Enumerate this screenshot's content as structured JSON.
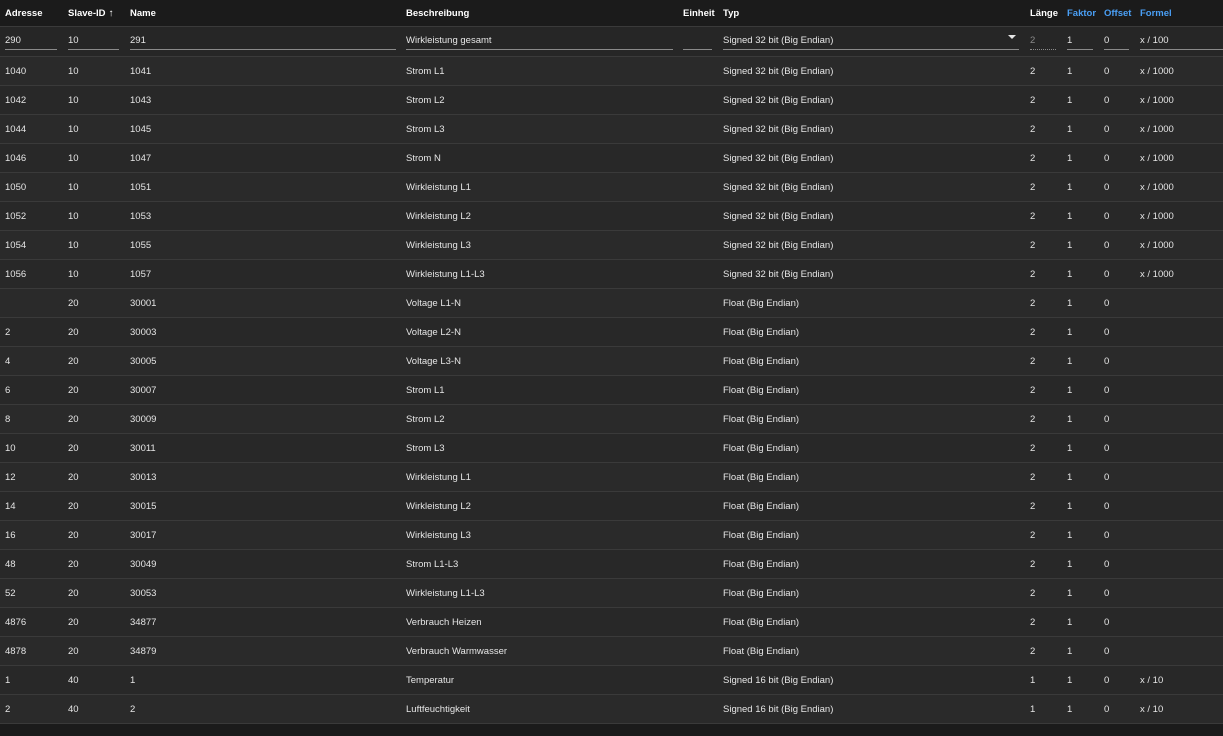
{
  "headers": {
    "adresse": "Adresse",
    "slave_id": "Slave-ID",
    "name": "Name",
    "beschreibung": "Beschreibung",
    "einheit": "Einheit",
    "typ": "Typ",
    "laenge": "Länge",
    "faktor": "Faktor",
    "offset": "Offset",
    "formel": "Formel",
    "sort_arrow": "↑"
  },
  "edit_row": {
    "adresse": "290",
    "slave_id": "10",
    "name": "291",
    "beschreibung": "Wirkleistung gesamt",
    "einheit": "",
    "typ": "Signed 32 bit (Big Endian)",
    "laenge": "2",
    "faktor": "1",
    "offset": "0",
    "formel": "x / 100"
  },
  "rows": [
    {
      "adresse": "1040",
      "slave_id": "10",
      "name": "1041",
      "beschreibung": "Strom L1",
      "einheit": "",
      "typ": "Signed 32 bit (Big Endian)",
      "laenge": "2",
      "faktor": "1",
      "offset": "0",
      "formel": "x / 1000"
    },
    {
      "adresse": "1042",
      "slave_id": "10",
      "name": "1043",
      "beschreibung": "Strom L2",
      "einheit": "",
      "typ": "Signed 32 bit (Big Endian)",
      "laenge": "2",
      "faktor": "1",
      "offset": "0",
      "formel": "x / 1000"
    },
    {
      "adresse": "1044",
      "slave_id": "10",
      "name": "1045",
      "beschreibung": "Strom L3",
      "einheit": "",
      "typ": "Signed 32 bit (Big Endian)",
      "laenge": "2",
      "faktor": "1",
      "offset": "0",
      "formel": "x / 1000"
    },
    {
      "adresse": "1046",
      "slave_id": "10",
      "name": "1047",
      "beschreibung": "Strom N",
      "einheit": "",
      "typ": "Signed 32 bit (Big Endian)",
      "laenge": "2",
      "faktor": "1",
      "offset": "0",
      "formel": "x / 1000"
    },
    {
      "adresse": "1050",
      "slave_id": "10",
      "name": "1051",
      "beschreibung": "Wirkleistung L1",
      "einheit": "",
      "typ": "Signed 32 bit (Big Endian)",
      "laenge": "2",
      "faktor": "1",
      "offset": "0",
      "formel": "x / 1000"
    },
    {
      "adresse": "1052",
      "slave_id": "10",
      "name": "1053",
      "beschreibung": "Wirkleistung L2",
      "einheit": "",
      "typ": "Signed 32 bit (Big Endian)",
      "laenge": "2",
      "faktor": "1",
      "offset": "0",
      "formel": "x / 1000"
    },
    {
      "adresse": "1054",
      "slave_id": "10",
      "name": "1055",
      "beschreibung": "Wirkleistung L3",
      "einheit": "",
      "typ": "Signed 32 bit (Big Endian)",
      "laenge": "2",
      "faktor": "1",
      "offset": "0",
      "formel": "x / 1000"
    },
    {
      "adresse": "1056",
      "slave_id": "10",
      "name": "1057",
      "beschreibung": "Wirkleistung L1-L3",
      "einheit": "",
      "typ": "Signed 32 bit (Big Endian)",
      "laenge": "2",
      "faktor": "1",
      "offset": "0",
      "formel": "x / 1000"
    },
    {
      "adresse": "",
      "slave_id": "20",
      "name": "30001",
      "beschreibung": "Voltage L1-N",
      "einheit": "",
      "typ": "Float (Big Endian)",
      "laenge": "2",
      "faktor": "1",
      "offset": "0",
      "formel": ""
    },
    {
      "adresse": "2",
      "slave_id": "20",
      "name": "30003",
      "beschreibung": "Voltage L2-N",
      "einheit": "",
      "typ": "Float (Big Endian)",
      "laenge": "2",
      "faktor": "1",
      "offset": "0",
      "formel": ""
    },
    {
      "adresse": "4",
      "slave_id": "20",
      "name": "30005",
      "beschreibung": "Voltage L3-N",
      "einheit": "",
      "typ": "Float (Big Endian)",
      "laenge": "2",
      "faktor": "1",
      "offset": "0",
      "formel": ""
    },
    {
      "adresse": "6",
      "slave_id": "20",
      "name": "30007",
      "beschreibung": "Strom L1",
      "einheit": "",
      "typ": "Float (Big Endian)",
      "laenge": "2",
      "faktor": "1",
      "offset": "0",
      "formel": ""
    },
    {
      "adresse": "8",
      "slave_id": "20",
      "name": "30009",
      "beschreibung": "Strom L2",
      "einheit": "",
      "typ": "Float (Big Endian)",
      "laenge": "2",
      "faktor": "1",
      "offset": "0",
      "formel": ""
    },
    {
      "adresse": "10",
      "slave_id": "20",
      "name": "30011",
      "beschreibung": "Strom L3",
      "einheit": "",
      "typ": "Float (Big Endian)",
      "laenge": "2",
      "faktor": "1",
      "offset": "0",
      "formel": ""
    },
    {
      "adresse": "12",
      "slave_id": "20",
      "name": "30013",
      "beschreibung": "Wirkleistung L1",
      "einheit": "",
      "typ": "Float (Big Endian)",
      "laenge": "2",
      "faktor": "1",
      "offset": "0",
      "formel": ""
    },
    {
      "adresse": "14",
      "slave_id": "20",
      "name": "30015",
      "beschreibung": "Wirkleistung L2",
      "einheit": "",
      "typ": "Float (Big Endian)",
      "laenge": "2",
      "faktor": "1",
      "offset": "0",
      "formel": ""
    },
    {
      "adresse": "16",
      "slave_id": "20",
      "name": "30017",
      "beschreibung": "Wirkleistung L3",
      "einheit": "",
      "typ": "Float (Big Endian)",
      "laenge": "2",
      "faktor": "1",
      "offset": "0",
      "formel": ""
    },
    {
      "adresse": "48",
      "slave_id": "20",
      "name": "30049",
      "beschreibung": "Strom L1-L3",
      "einheit": "",
      "typ": "Float (Big Endian)",
      "laenge": "2",
      "faktor": "1",
      "offset": "0",
      "formel": ""
    },
    {
      "adresse": "52",
      "slave_id": "20",
      "name": "30053",
      "beschreibung": "Wirkleistung L1-L3",
      "einheit": "",
      "typ": "Float (Big Endian)",
      "laenge": "2",
      "faktor": "1",
      "offset": "0",
      "formel": ""
    },
    {
      "adresse": "4876",
      "slave_id": "20",
      "name": "34877",
      "beschreibung": "Verbrauch Heizen",
      "einheit": "",
      "typ": "Float (Big Endian)",
      "laenge": "2",
      "faktor": "1",
      "offset": "0",
      "formel": ""
    },
    {
      "adresse": "4878",
      "slave_id": "20",
      "name": "34879",
      "beschreibung": "Verbrauch Warmwasser",
      "einheit": "",
      "typ": "Float (Big Endian)",
      "laenge": "2",
      "faktor": "1",
      "offset": "0",
      "formel": ""
    },
    {
      "adresse": "1",
      "slave_id": "40",
      "name": "1",
      "beschreibung": "Temperatur",
      "einheit": "",
      "typ": "Signed 16 bit (Big Endian)",
      "laenge": "1",
      "faktor": "1",
      "offset": "0",
      "formel": "x / 10"
    },
    {
      "adresse": "2",
      "slave_id": "40",
      "name": "2",
      "beschreibung": "Luftfeuchtigkeit",
      "einheit": "",
      "typ": "Signed 16 bit (Big Endian)",
      "laenge": "1",
      "faktor": "1",
      "offset": "0",
      "formel": "x / 10"
    }
  ]
}
